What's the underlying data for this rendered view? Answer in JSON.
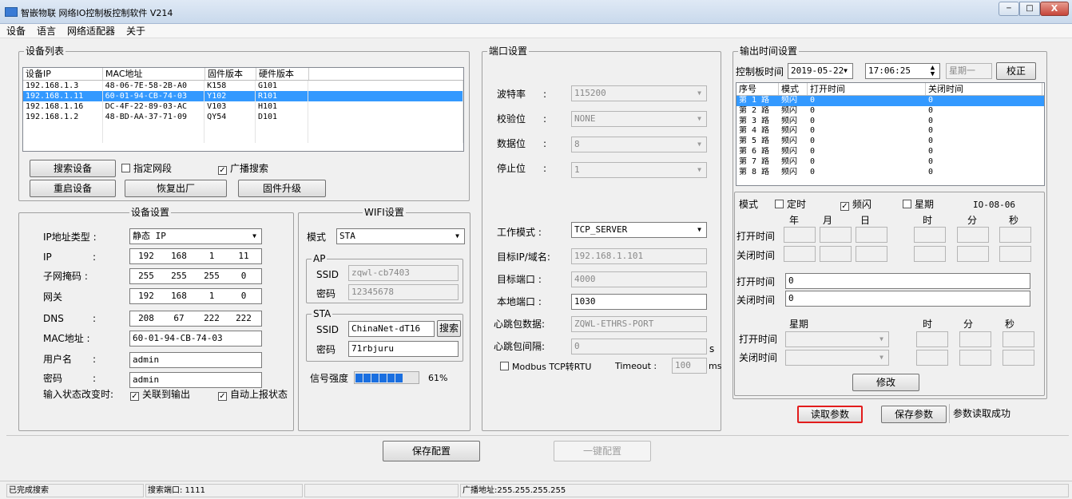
{
  "window": {
    "title": "智嵌物联 网络IO控制板控制软件  V214",
    "min": "─",
    "max": "□",
    "close": "X"
  },
  "menu": [
    "设备",
    "语言",
    "网络适配器",
    "关于"
  ],
  "device_list": {
    "group": "设备列表",
    "columns": [
      "设备IP",
      "MAC地址",
      "固件版本",
      "硬件版本"
    ],
    "rows": [
      [
        "192.168.1.3",
        "48-06-7E-58-2B-A0",
        "K158",
        "G101"
      ],
      [
        "192.168.1.11",
        "60-01-94-CB-74-03",
        "Y102",
        "R101"
      ],
      [
        "192.168.1.16",
        "DC-4F-22-89-03-AC",
        "V103",
        "H101"
      ],
      [
        "192.168.1.2",
        "48-BD-AA-37-71-09",
        "QY54",
        "D101"
      ]
    ],
    "selected_row": 1,
    "search_btn": "搜索设备",
    "specify_seg": "指定网段",
    "broadcast_search": "广播搜索",
    "restart_btn": "重启设备",
    "factory_btn": "恢复出厂",
    "firmware_btn": "固件升级"
  },
  "device_settings": {
    "group": "设备设置",
    "ip_type_label": "IP地址类型 :",
    "ip_type": "静态 IP",
    "ip_label": "IP",
    "ip": [
      "192",
      "168",
      "1",
      "11"
    ],
    "mask_label": "子网掩码 :",
    "mask": [
      "255",
      "255",
      "255",
      "0"
    ],
    "gw_label": "网关",
    "gw": [
      "192",
      "168",
      "1",
      "0"
    ],
    "dns_label": "DNS",
    "dns": [
      "208",
      "67",
      "222",
      "222"
    ],
    "colon": ":",
    "mac_label": "MAC地址 :",
    "mac": "60-01-94-CB-74-03",
    "user_label": "用户名",
    "user": "admin",
    "pwd_label": "密码",
    "pwd": "admin",
    "input_change_label": "输入状态改变时:",
    "link_output": "关联到输出",
    "auto_report": "自动上报状态"
  },
  "wifi": {
    "group": "WIFI设置",
    "mode_label": "模式",
    "mode": "STA",
    "ap_group": "AP",
    "ap_ssid_label": "SSID",
    "ap_ssid": "zqwl-cb7403",
    "ap_pwd_label": "密码",
    "ap_pwd": "12345678",
    "sta_group": "STA",
    "sta_ssid_label": "SSID",
    "sta_ssid": "ChinaNet-dT16",
    "search_btn": "搜索",
    "sta_pwd_label": "密码",
    "sta_pwd": "71rbjuru",
    "signal_label": "信号强度",
    "signal_pct": "61%",
    "signal_value": 0.61
  },
  "port": {
    "group": "端口设置",
    "baud_label": "波特率",
    "baud": "115200",
    "parity_label": "校验位",
    "parity": "NONE",
    "data_label": "数据位",
    "data": "8",
    "stop_label": "停止位",
    "stop": "1",
    "colon": ":",
    "work_mode_label": "工作模式 :",
    "work_mode": "TCP_SERVER",
    "target_ip_label": "目标IP/域名:",
    "target_ip": "192.168.1.101",
    "target_port_label": "目标端口 :",
    "target_port": "4000",
    "local_port_label": "本地端口 :",
    "local_port": "1030",
    "heartbeat_label": "心跳包数据:",
    "heartbeat": "ZQWL-ETHRS-PORT",
    "hb_interval_label": "心跳包间隔:",
    "hb_interval": "0",
    "s_unit": "s",
    "modbus_label": "Modbus TCP转RTU",
    "timeout_label": "Timeout :",
    "timeout": "100",
    "ms_unit": "ms"
  },
  "output_time": {
    "group": "输出时间设置",
    "board_time_label": "控制板时间",
    "date": "2019-05-22",
    "time": "17:06:25",
    "weekday": "星期一",
    "calibrate_btn": "校正",
    "columns": [
      "序号",
      "模式",
      "打开时间",
      "关闭时间"
    ],
    "rows": [
      [
        "第 1 路",
        "频闪",
        "0",
        "0"
      ],
      [
        "第 2 路",
        "频闪",
        "0",
        "0"
      ],
      [
        "第 3 路",
        "频闪",
        "0",
        "0"
      ],
      [
        "第 4 路",
        "频闪",
        "0",
        "0"
      ],
      [
        "第 5 路",
        "频闪",
        "0",
        "0"
      ],
      [
        "第 6 路",
        "频闪",
        "0",
        "0"
      ],
      [
        "第 7 路",
        "频闪",
        "0",
        "0"
      ],
      [
        "第 8 路",
        "频闪",
        "0",
        "0"
      ]
    ],
    "mode_label": "模式",
    "timed": "定时",
    "flash": "频闪",
    "week": "星期",
    "code": "IO-08-06",
    "ymd": [
      "年",
      "月",
      "日"
    ],
    "hms": [
      "时",
      "分",
      "秒"
    ],
    "open_time": "打开时间",
    "close_time": "关闭时间",
    "open_val": "0",
    "close_val": "0",
    "week_label": "星期",
    "modify_btn": "修改"
  },
  "actions": {
    "read_params": "读取参数",
    "save_params": "保存参数",
    "status": "参数读取成功",
    "save_config": "保存配置",
    "one_key": "一键配置"
  },
  "statusbar": {
    "s1": "已完成搜索",
    "s2": "搜索端口: 1111",
    "s3": "",
    "s4": "广播地址:255.255.255.255"
  }
}
